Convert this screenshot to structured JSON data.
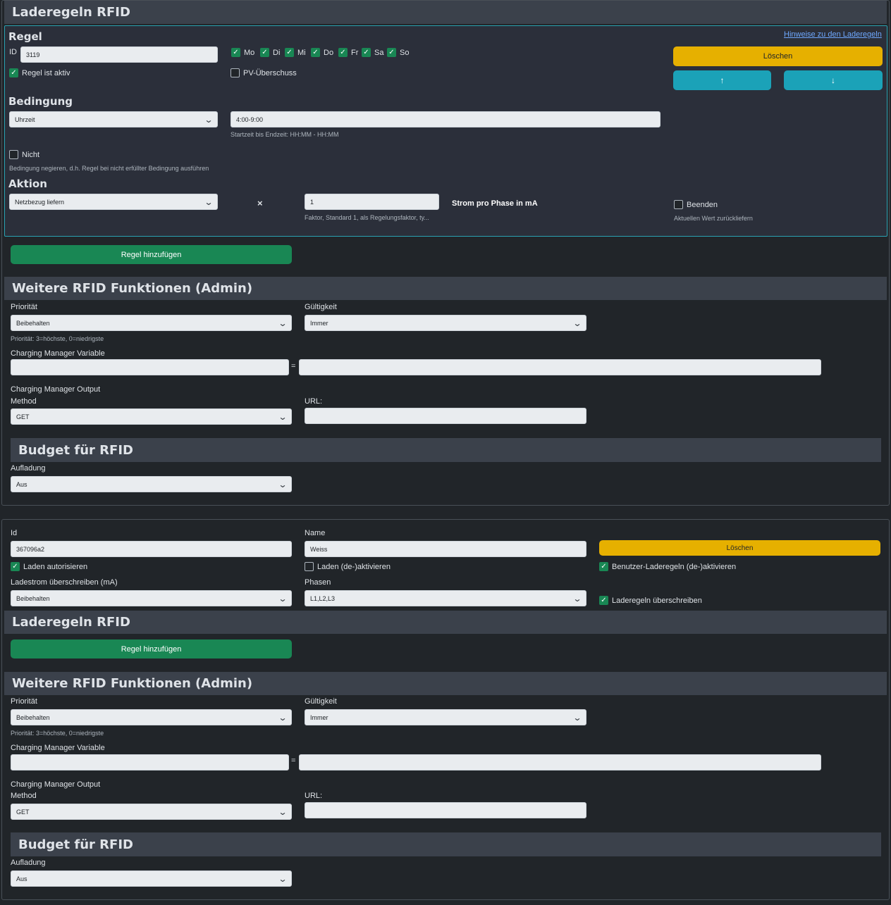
{
  "card1": {
    "header": "Laderegeln RFID",
    "rule": {
      "heading": "Regel",
      "hint_link": "Hinweise zu den Laderegeln",
      "id_label": "ID",
      "id_value": "3119",
      "days": [
        {
          "label": "Mo",
          "checked": true
        },
        {
          "label": "Di",
          "checked": true
        },
        {
          "label": "Mi",
          "checked": true
        },
        {
          "label": "Do",
          "checked": true
        },
        {
          "label": "Fr",
          "checked": true
        },
        {
          "label": "Sa",
          "checked": true
        },
        {
          "label": "So",
          "checked": true
        }
      ],
      "active_label": "Regel ist aktiv",
      "pv_label": "PV-Überschuss",
      "delete_label": "Löschen",
      "up_icon": "↑",
      "down_icon": "↓",
      "condition_heading": "Bedingung",
      "condition_select": "Uhrzeit",
      "condition_value": "4:00-9:00",
      "condition_hint": "Startzeit bis Endzeit: HH:MM - HH:MM",
      "not_label": "Nicht",
      "not_hint": "Bedingung negieren, d.h. Regel bei nicht erfüllter Bedingung ausführen",
      "action_heading": "Aktion",
      "action_select": "Netzbezug liefern",
      "times": "×",
      "factor_value": "1",
      "factor_hint": "Faktor, Standard 1, als Regelungsfaktor, ty...",
      "unit_label": "Strom pro Phase in mA",
      "end_label": "Beenden",
      "end_hint": "Aktuellen Wert zurückliefern"
    },
    "add_rule": "Regel hinzufügen",
    "admin": {
      "header": "Weitere RFID Funktionen (Admin)",
      "priority_label": "Priorität",
      "priority_value": "Beibehalten",
      "priority_hint": "Priorität: 3=höchste, 0=niedrigste",
      "validity_label": "Gültigkeit",
      "validity_value": "Immer",
      "cm_var_label": "Charging Manager Variable",
      "eq": "=",
      "cm_out_label": "Charging Manager Output",
      "method_label": "Method",
      "method_value": "GET",
      "url_label": "URL:"
    },
    "budget": {
      "header": "Budget für RFID",
      "charge_label": "Aufladung",
      "charge_value": "Aus"
    }
  },
  "card2": {
    "id_label": "Id",
    "id_value": "367096a2",
    "name_label": "Name",
    "name_value": "Weiss",
    "delete_label": "Löschen",
    "auth_label": "Laden autorisieren",
    "toggle_label": "Laden (de-)aktivieren",
    "user_rules_label": "Benutzer-Laderegeln (de-)aktivieren",
    "current_label": "Ladestrom überschreiben (mA)",
    "current_value": "Beibehalten",
    "phases_label": "Phasen",
    "phases_value": "L1,L2,L3",
    "override_label": "Laderegeln überschreiben",
    "header": "Laderegeln RFID",
    "add_rule": "Regel hinzufügen",
    "admin": {
      "header": "Weitere RFID Funktionen (Admin)",
      "priority_label": "Priorität",
      "priority_value": "Beibehalten",
      "priority_hint": "Priorität: 3=höchste, 0=niedrigste",
      "validity_label": "Gültigkeit",
      "validity_value": "Immer",
      "cm_var_label": "Charging Manager Variable",
      "eq": "=",
      "cm_out_label": "Charging Manager Output",
      "method_label": "Method",
      "method_value": "GET",
      "url_label": "URL:"
    },
    "budget": {
      "header": "Budget für RFID",
      "charge_label": "Aufladung",
      "charge_value": "Aus"
    }
  }
}
